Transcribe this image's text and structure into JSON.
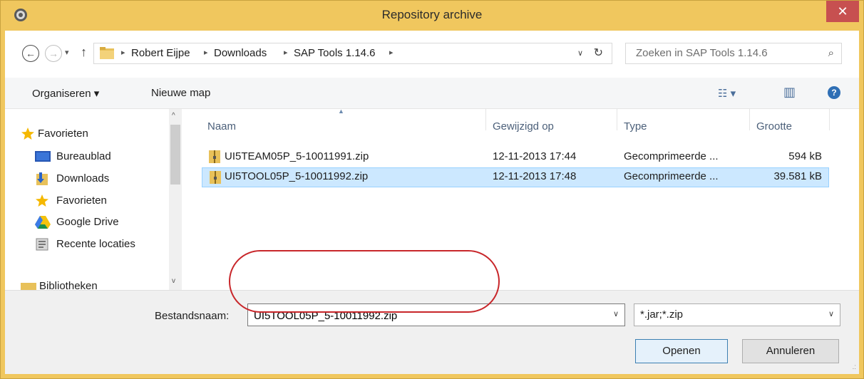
{
  "window": {
    "title": "Repository archive",
    "close_glyph": "✕",
    "app_icon": "gear-icon",
    "accent": "#f0c75e"
  },
  "nav": {
    "back_glyph": "←",
    "forward_glyph": "→",
    "recent_glyph": "▾",
    "up_glyph": "↑",
    "breadcrumbs": [
      "Robert Eijpe",
      "Downloads",
      "SAP Tools 1.14.6"
    ],
    "sep_glyph": "▸",
    "dropdown_glyph": "∨",
    "refresh_glyph": "↻",
    "search_placeholder": "Zoeken in SAP Tools 1.14.6",
    "search_glyph": "⌕"
  },
  "toolbar": {
    "organize_label": "Organiseren ▾",
    "new_folder_label": "Nieuwe map",
    "view_glyph": "☷ ▾",
    "pane_glyph": "▥",
    "help_glyph": "?"
  },
  "sidebar": {
    "items": [
      {
        "label": "Favorieten",
        "icon": "star-icon"
      },
      {
        "label": "Bureaublad",
        "icon": "desktop-icon"
      },
      {
        "label": "Downloads",
        "icon": "downloads-icon"
      },
      {
        "label": "Favorieten",
        "icon": "star-icon"
      },
      {
        "label": "Google Drive",
        "icon": "google-drive-icon"
      },
      {
        "label": "Recente locaties",
        "icon": "recent-places-icon"
      },
      {
        "label": "Bibliotheken",
        "icon": "libraries-icon"
      }
    ],
    "scroll_up": "^",
    "scroll_down": "v"
  },
  "files": {
    "columns": [
      "Naam",
      "Gewijzigd op",
      "Type",
      "Grootte"
    ],
    "sort_glyph": "▲",
    "rows": [
      {
        "name": "UI5TEAM05P_5-10011991.zip",
        "date": "12-11-2013 17:44",
        "type": "Gecomprimeerde ...",
        "size": "594 kB",
        "selected": false
      },
      {
        "name": "UI5TOOL05P_5-10011992.zip",
        "date": "12-11-2013 17:48",
        "type": "Gecomprimeerde ...",
        "size": "39.581 kB",
        "selected": true
      }
    ]
  },
  "footer": {
    "filename_label": "Bestandsnaam:",
    "filename_value": "UI5TOOL05P_5-10011992.zip",
    "filter_value": "*.jar;*.zip",
    "caret_glyph": "∨",
    "open_label": "Openen",
    "cancel_label": "Annuleren",
    "grip_glyph": ".:"
  }
}
